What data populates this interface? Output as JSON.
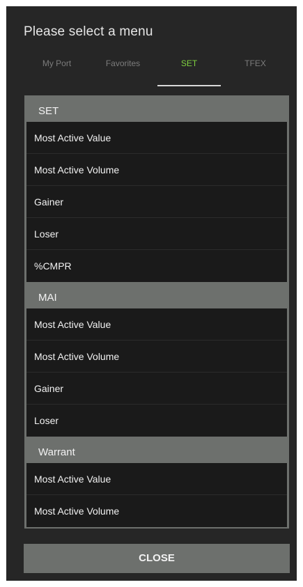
{
  "dialog": {
    "title": "Please select a menu",
    "tabs": [
      {
        "label": "My Port"
      },
      {
        "label": "Favorites"
      },
      {
        "label": "SET"
      },
      {
        "label": "TFEX"
      }
    ],
    "active_tab": "SET",
    "colors": {
      "background": "#262626",
      "active_tab": "#7fd140",
      "section_header": "#6d706d",
      "item_background": "#1a1a1a"
    },
    "sections": [
      {
        "title": "SET",
        "items": [
          "Most Active Value",
          "Most Active Volume",
          "Gainer",
          "Loser",
          "%CMPR"
        ]
      },
      {
        "title": "MAI",
        "items": [
          "Most Active Value",
          "Most Active Volume",
          "Gainer",
          "Loser"
        ]
      },
      {
        "title": "Warrant",
        "items": [
          "Most Active Value",
          "Most Active Volume"
        ]
      }
    ],
    "close_label": "CLOSE"
  }
}
